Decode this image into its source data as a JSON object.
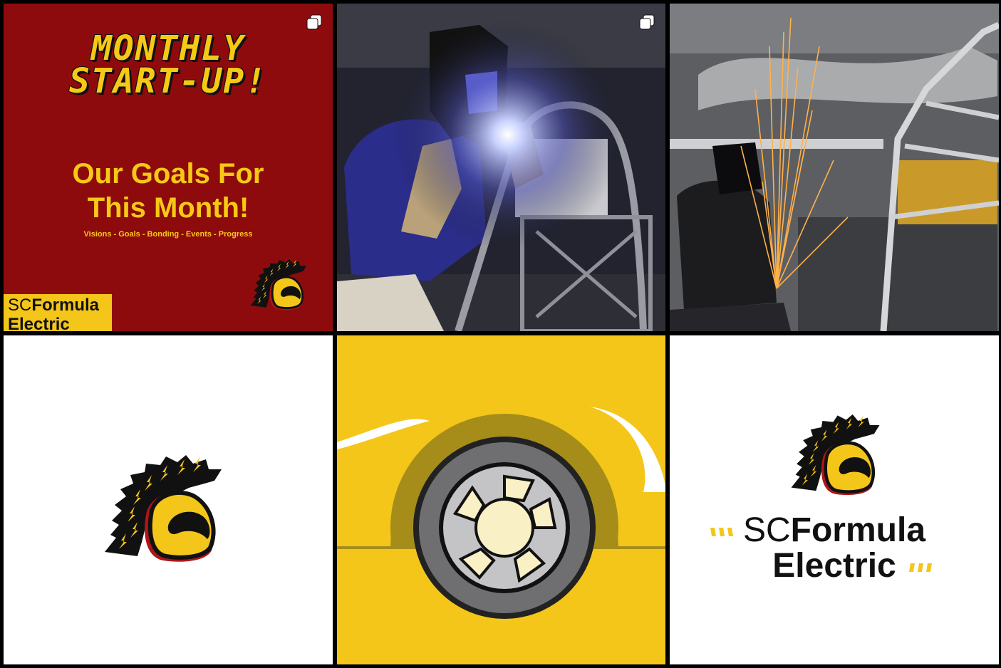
{
  "grid": {
    "posts": [
      {
        "kind": "poster",
        "carousel": true,
        "headline_lines": [
          "MONTHLY",
          "START-UP!"
        ],
        "goals_lines": [
          "Our Goals For",
          "This Month!"
        ],
        "subline": "Visions - Goals - Bonding - Events - Progress",
        "badge": {
          "sc": "SC",
          "formula": "Formula",
          "electric": "Electric"
        }
      },
      {
        "kind": "photo",
        "carousel": true,
        "subject": "welding-car-frame"
      },
      {
        "kind": "photo",
        "carousel": false,
        "subject": "grinding-sparks"
      },
      {
        "kind": "mascot-logo"
      },
      {
        "kind": "tire-illustration"
      },
      {
        "kind": "wordmark",
        "logo": {
          "sc": "SC",
          "formula": "Formula",
          "electric": "Electric"
        }
      }
    ]
  },
  "colors": {
    "maroon": "#8e0b0d",
    "gold": "#f4c61a",
    "black": "#111111",
    "white": "#ffffff"
  },
  "icons": [
    "carousel-icon",
    "trojan-helmet-icon"
  ]
}
